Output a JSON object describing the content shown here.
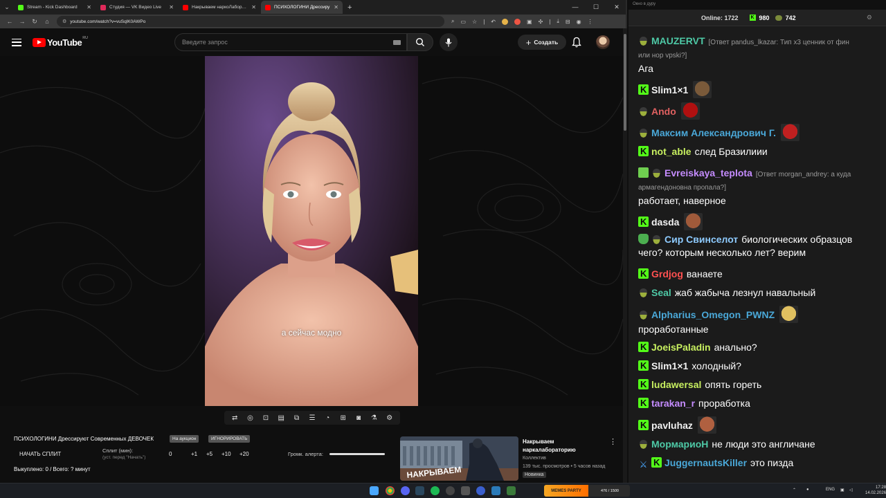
{
  "browser": {
    "tabs": [
      {
        "title": "Stream - Kick Dashboard",
        "color": "#53fc18",
        "active": false
      },
      {
        "title": "Студия — VK Видео Live",
        "color": "#e02a5a",
        "active": false
      },
      {
        "title": "Накрываем наркоЛабораторию",
        "color": "#ff0000",
        "active": false
      },
      {
        "title": "ПСИХОЛОГИНИ Дрессиру",
        "color": "#ff0000",
        "active": true
      }
    ],
    "url": "youtube.com/watch?v=vuSqlK0AWPo"
  },
  "youtube": {
    "logo": "YouTube",
    "region": "RU",
    "search_placeholder": "Введите запрос",
    "create_label": "Создать",
    "subtitle": "а сейчас модно",
    "video_title": "ПСИХОЛОГИНИ Дрессируют Современных ДЕВОЧЕК",
    "pill_auction": "На аукцион",
    "pill_ignore": "ИГНОРИРОВАТЬ",
    "start_split": "НАЧАТЬ СПЛИТ",
    "split_label": "Сплит (мин):",
    "split_hint": "(уст. перед \"Начать\")",
    "split_values": [
      "0",
      "+1",
      "+5",
      "+10",
      "+20"
    ],
    "alert_volume": "Громк. алерта:",
    "alert_volume_level": 1.0,
    "bought": "Выкуплено: 0 / Всего: ? минут",
    "recommendation": {
      "title": "Накрываем наркалабораторию",
      "channel": "Коллектив",
      "meta": "139 тыс. просмотров • 5 часов назад",
      "badge": "Новинка",
      "thumb_text": "НАКРЫВАЕМ"
    }
  },
  "chat": {
    "window_title": "Окно в дуру",
    "online_label": "Online:",
    "online_count": "1722",
    "kick_count": "980",
    "other_count": "742",
    "messages": [
      {
        "badges": [
          "pepe"
        ],
        "user": "MAUZERVT",
        "color": "#4ec9a6",
        "reply": "[Ответ pandus_lkazar: Тип x3 ценник от фин",
        "reply2": "или нор vpski?]",
        "text": "Ага"
      },
      {
        "badges": [
          "kick"
        ],
        "user": "Slim1×1",
        "color": "#f1f1f1",
        "text": "",
        "emote": "#7a5a3a"
      },
      {
        "badges": [
          "pepe"
        ],
        "user": "Ando",
        "color": "#e06060",
        "text": "",
        "emote": "#b01010"
      },
      {
        "badges": [
          "pepe"
        ],
        "user": "Максим Александрович Г.",
        "color": "#4aa8d8",
        "text": "",
        "emote": "#c02020"
      },
      {
        "badges": [
          "kick"
        ],
        "user": "not_able",
        "color": "#c8f060",
        "text": "след Бразилиии"
      },
      {
        "badges": [
          "check",
          "pepe"
        ],
        "user": "Evreiskaya_teplota",
        "color": "#c58cff",
        "reply": "[Ответ morgan_andrey: а куда",
        "reply2": "армагендоновна пропала?]",
        "text": "работает, наверное"
      },
      {
        "badges": [
          "kick"
        ],
        "user": "dasda",
        "color": "#f1f1f1",
        "text": "",
        "emote": "#a05a3a"
      },
      {
        "badges": [
          "shield",
          "pepe"
        ],
        "user": "Сир Свинселот",
        "color": "#8ecbff",
        "text": "биологических образцов",
        "text2": "чего? которым несколько лет? верим"
      },
      {
        "badges": [
          "kick"
        ],
        "user": "Grdjog",
        "color": "#ff5050",
        "text": "ванаете"
      },
      {
        "badges": [
          "pepe"
        ],
        "user": "Seal",
        "color": "#4ec9a6",
        "text": "жаб жабыча лезнул навальный"
      },
      {
        "badges": [
          "pepe"
        ],
        "user": "Alpharius_Omegon_PWNZ",
        "color": "#4aa8d8",
        "text": "",
        "text2": "проработанные",
        "emote": "#e0c060"
      },
      {
        "badges": [
          "kick"
        ],
        "user": "JoeisPaladin",
        "color": "#c8f060",
        "text": "анально?"
      },
      {
        "badges": [
          "kick"
        ],
        "user": "Slim1×1",
        "color": "#f1f1f1",
        "text": "холодный?"
      },
      {
        "badges": [
          "kick"
        ],
        "user": "ludawersal",
        "color": "#c8f060",
        "text": "опять гореть"
      },
      {
        "badges": [
          "kick"
        ],
        "user": "tarakan_r",
        "color": "#c58cff",
        "text": "проработка"
      },
      {
        "badges": [
          "kick"
        ],
        "user": "pavluhaz",
        "color": "#f1f1f1",
        "text": "",
        "emote": "#b06040"
      },
      {
        "badges": [
          "pepe"
        ],
        "user": "МормариоН",
        "color": "#4ec9a6",
        "text": "не люди это англичане"
      },
      {
        "badges": [
          "sword",
          "kick"
        ],
        "user": "JuggernautsKiller",
        "color": "#4aa8d8",
        "text": "это пизда"
      }
    ]
  },
  "taskbar": {
    "media_title": "MEMES PARTY",
    "media_time": "476 / 1500",
    "lang": "ENG",
    "time": "17:28",
    "date": "14.02.2026"
  }
}
